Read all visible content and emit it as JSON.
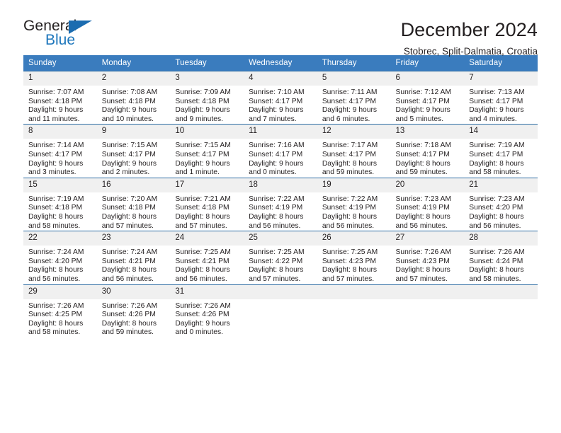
{
  "logo": {
    "primary_text": "General",
    "secondary_text": "Blue",
    "triangle_color": "#1b6cb0",
    "secondary_color": "#1b75bb"
  },
  "header": {
    "title": "December 2024",
    "subtitle": "Stobrec, Split-Dalmatia, Croatia"
  },
  "colors": {
    "header_background": "#3a7cbe",
    "row_border": "#2e6da4",
    "daynum_background": "#f0f0f0",
    "text": "#231f20"
  },
  "weekday_headers": [
    "Sunday",
    "Monday",
    "Tuesday",
    "Wednesday",
    "Thursday",
    "Friday",
    "Saturday"
  ],
  "weeks": [
    [
      {
        "day": "1",
        "sunrise": "Sunrise: 7:07 AM",
        "sunset": "Sunset: 4:18 PM",
        "daylight_1": "Daylight: 9 hours",
        "daylight_2": "and 11 minutes."
      },
      {
        "day": "2",
        "sunrise": "Sunrise: 7:08 AM",
        "sunset": "Sunset: 4:18 PM",
        "daylight_1": "Daylight: 9 hours",
        "daylight_2": "and 10 minutes."
      },
      {
        "day": "3",
        "sunrise": "Sunrise: 7:09 AM",
        "sunset": "Sunset: 4:18 PM",
        "daylight_1": "Daylight: 9 hours",
        "daylight_2": "and 9 minutes."
      },
      {
        "day": "4",
        "sunrise": "Sunrise: 7:10 AM",
        "sunset": "Sunset: 4:17 PM",
        "daylight_1": "Daylight: 9 hours",
        "daylight_2": "and 7 minutes."
      },
      {
        "day": "5",
        "sunrise": "Sunrise: 7:11 AM",
        "sunset": "Sunset: 4:17 PM",
        "daylight_1": "Daylight: 9 hours",
        "daylight_2": "and 6 minutes."
      },
      {
        "day": "6",
        "sunrise": "Sunrise: 7:12 AM",
        "sunset": "Sunset: 4:17 PM",
        "daylight_1": "Daylight: 9 hours",
        "daylight_2": "and 5 minutes."
      },
      {
        "day": "7",
        "sunrise": "Sunrise: 7:13 AM",
        "sunset": "Sunset: 4:17 PM",
        "daylight_1": "Daylight: 9 hours",
        "daylight_2": "and 4 minutes."
      }
    ],
    [
      {
        "day": "8",
        "sunrise": "Sunrise: 7:14 AM",
        "sunset": "Sunset: 4:17 PM",
        "daylight_1": "Daylight: 9 hours",
        "daylight_2": "and 3 minutes."
      },
      {
        "day": "9",
        "sunrise": "Sunrise: 7:15 AM",
        "sunset": "Sunset: 4:17 PM",
        "daylight_1": "Daylight: 9 hours",
        "daylight_2": "and 2 minutes."
      },
      {
        "day": "10",
        "sunrise": "Sunrise: 7:15 AM",
        "sunset": "Sunset: 4:17 PM",
        "daylight_1": "Daylight: 9 hours",
        "daylight_2": "and 1 minute."
      },
      {
        "day": "11",
        "sunrise": "Sunrise: 7:16 AM",
        "sunset": "Sunset: 4:17 PM",
        "daylight_1": "Daylight: 9 hours",
        "daylight_2": "and 0 minutes."
      },
      {
        "day": "12",
        "sunrise": "Sunrise: 7:17 AM",
        "sunset": "Sunset: 4:17 PM",
        "daylight_1": "Daylight: 8 hours",
        "daylight_2": "and 59 minutes."
      },
      {
        "day": "13",
        "sunrise": "Sunrise: 7:18 AM",
        "sunset": "Sunset: 4:17 PM",
        "daylight_1": "Daylight: 8 hours",
        "daylight_2": "and 59 minutes."
      },
      {
        "day": "14",
        "sunrise": "Sunrise: 7:19 AM",
        "sunset": "Sunset: 4:17 PM",
        "daylight_1": "Daylight: 8 hours",
        "daylight_2": "and 58 minutes."
      }
    ],
    [
      {
        "day": "15",
        "sunrise": "Sunrise: 7:19 AM",
        "sunset": "Sunset: 4:18 PM",
        "daylight_1": "Daylight: 8 hours",
        "daylight_2": "and 58 minutes."
      },
      {
        "day": "16",
        "sunrise": "Sunrise: 7:20 AM",
        "sunset": "Sunset: 4:18 PM",
        "daylight_1": "Daylight: 8 hours",
        "daylight_2": "and 57 minutes."
      },
      {
        "day": "17",
        "sunrise": "Sunrise: 7:21 AM",
        "sunset": "Sunset: 4:18 PM",
        "daylight_1": "Daylight: 8 hours",
        "daylight_2": "and 57 minutes."
      },
      {
        "day": "18",
        "sunrise": "Sunrise: 7:22 AM",
        "sunset": "Sunset: 4:19 PM",
        "daylight_1": "Daylight: 8 hours",
        "daylight_2": "and 56 minutes."
      },
      {
        "day": "19",
        "sunrise": "Sunrise: 7:22 AM",
        "sunset": "Sunset: 4:19 PM",
        "daylight_1": "Daylight: 8 hours",
        "daylight_2": "and 56 minutes."
      },
      {
        "day": "20",
        "sunrise": "Sunrise: 7:23 AM",
        "sunset": "Sunset: 4:19 PM",
        "daylight_1": "Daylight: 8 hours",
        "daylight_2": "and 56 minutes."
      },
      {
        "day": "21",
        "sunrise": "Sunrise: 7:23 AM",
        "sunset": "Sunset: 4:20 PM",
        "daylight_1": "Daylight: 8 hours",
        "daylight_2": "and 56 minutes."
      }
    ],
    [
      {
        "day": "22",
        "sunrise": "Sunrise: 7:24 AM",
        "sunset": "Sunset: 4:20 PM",
        "daylight_1": "Daylight: 8 hours",
        "daylight_2": "and 56 minutes."
      },
      {
        "day": "23",
        "sunrise": "Sunrise: 7:24 AM",
        "sunset": "Sunset: 4:21 PM",
        "daylight_1": "Daylight: 8 hours",
        "daylight_2": "and 56 minutes."
      },
      {
        "day": "24",
        "sunrise": "Sunrise: 7:25 AM",
        "sunset": "Sunset: 4:21 PM",
        "daylight_1": "Daylight: 8 hours",
        "daylight_2": "and 56 minutes."
      },
      {
        "day": "25",
        "sunrise": "Sunrise: 7:25 AM",
        "sunset": "Sunset: 4:22 PM",
        "daylight_1": "Daylight: 8 hours",
        "daylight_2": "and 57 minutes."
      },
      {
        "day": "26",
        "sunrise": "Sunrise: 7:25 AM",
        "sunset": "Sunset: 4:23 PM",
        "daylight_1": "Daylight: 8 hours",
        "daylight_2": "and 57 minutes."
      },
      {
        "day": "27",
        "sunrise": "Sunrise: 7:26 AM",
        "sunset": "Sunset: 4:23 PM",
        "daylight_1": "Daylight: 8 hours",
        "daylight_2": "and 57 minutes."
      },
      {
        "day": "28",
        "sunrise": "Sunrise: 7:26 AM",
        "sunset": "Sunset: 4:24 PM",
        "daylight_1": "Daylight: 8 hours",
        "daylight_2": "and 58 minutes."
      }
    ],
    [
      {
        "day": "29",
        "sunrise": "Sunrise: 7:26 AM",
        "sunset": "Sunset: 4:25 PM",
        "daylight_1": "Daylight: 8 hours",
        "daylight_2": "and 58 minutes."
      },
      {
        "day": "30",
        "sunrise": "Sunrise: 7:26 AM",
        "sunset": "Sunset: 4:26 PM",
        "daylight_1": "Daylight: 8 hours",
        "daylight_2": "and 59 minutes."
      },
      {
        "day": "31",
        "sunrise": "Sunrise: 7:26 AM",
        "sunset": "Sunset: 4:26 PM",
        "daylight_1": "Daylight: 9 hours",
        "daylight_2": "and 0 minutes."
      },
      {
        "day": "",
        "sunrise": "",
        "sunset": "",
        "daylight_1": "",
        "daylight_2": ""
      },
      {
        "day": "",
        "sunrise": "",
        "sunset": "",
        "daylight_1": "",
        "daylight_2": ""
      },
      {
        "day": "",
        "sunrise": "",
        "sunset": "",
        "daylight_1": "",
        "daylight_2": ""
      },
      {
        "day": "",
        "sunrise": "",
        "sunset": "",
        "daylight_1": "",
        "daylight_2": ""
      }
    ]
  ]
}
